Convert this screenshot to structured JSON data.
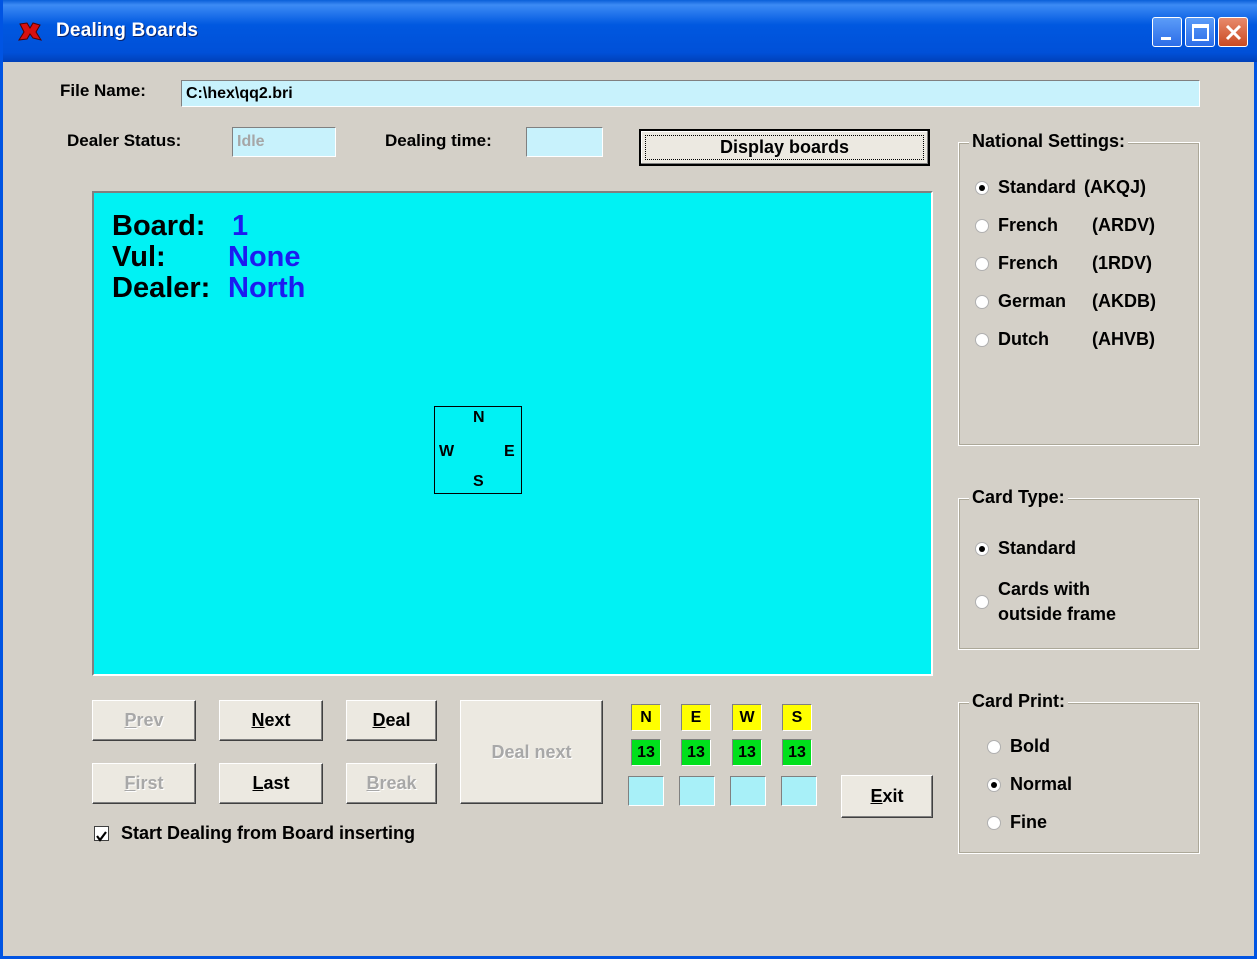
{
  "window": {
    "title": "Dealing Boards"
  },
  "file": {
    "label": "File Name:",
    "value": "C:\\hex\\qq2.bri"
  },
  "status": {
    "dealer_label": "Dealer Status:",
    "dealer_value": "Idle",
    "time_label": "Dealing time:",
    "time_value": "",
    "display_button": "Display boards"
  },
  "board": {
    "board_label": "Board:",
    "board_value": "1",
    "vul_label": "Vul:",
    "vul_value": "None",
    "dealer_label": "Dealer:",
    "dealer_value": "North",
    "compass": {
      "n": "N",
      "e": "E",
      "s": "S",
      "w": "W"
    }
  },
  "nav": {
    "prev": "Prev",
    "next": "Next",
    "deal": "Deal",
    "first": "First",
    "last": "Last",
    "break": "Break",
    "deal_next": "Deal next",
    "exit": "Exit"
  },
  "counts": {
    "seats": [
      "N",
      "E",
      "W",
      "S"
    ],
    "cards": [
      "13",
      "13",
      "13",
      "13"
    ]
  },
  "checkbox": {
    "label": "Start Dealing from Board inserting",
    "checked": true
  },
  "national": {
    "title": "National Settings:",
    "options": [
      {
        "name": "Standard",
        "code": "(AKQJ)",
        "selected": true
      },
      {
        "name": "French",
        "code": "(ARDV)",
        "selected": false
      },
      {
        "name": "French",
        "code": "(1RDV)",
        "selected": false
      },
      {
        "name": "German",
        "code": "(AKDB)",
        "selected": false
      },
      {
        "name": "Dutch",
        "code": "(AHVB)",
        "selected": false
      }
    ]
  },
  "card_type": {
    "title": "Card Type:",
    "options": [
      {
        "label": "Standard",
        "selected": true
      },
      {
        "label": "Cards with",
        "label2": "outside frame",
        "selected": false
      }
    ]
  },
  "card_print": {
    "title": "Card Print:",
    "options": [
      {
        "label": "Bold",
        "selected": false
      },
      {
        "label": "Normal",
        "selected": true
      },
      {
        "label": "Fine",
        "selected": false
      }
    ]
  },
  "colors": {
    "board_bg": "#00f2f4",
    "value_blue": "#1c1cf0",
    "seat_yellow": "#ffff00",
    "count_green": "#00e01c"
  }
}
